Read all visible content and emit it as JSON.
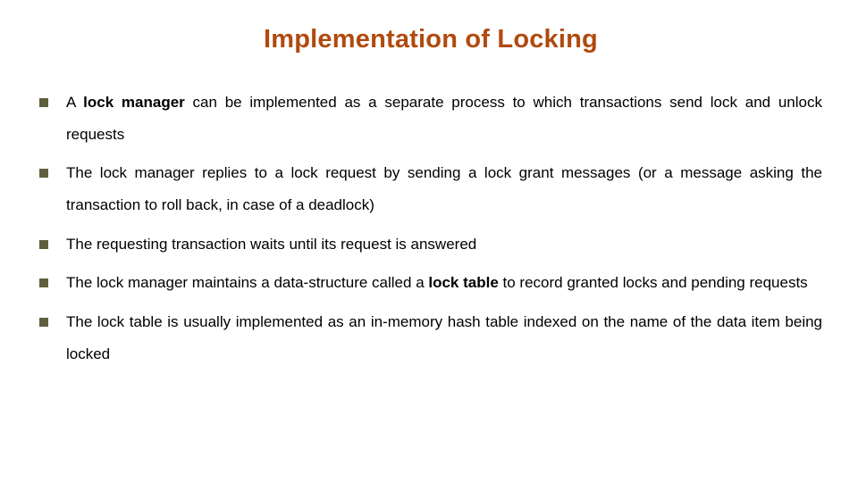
{
  "title": "Implementation of Locking",
  "bullets": [
    {
      "pre": "A ",
      "bold": "lock manager",
      "post": " can be implemented as a separate process to which transactions send lock and unlock requests"
    },
    {
      "pre": "The lock manager replies to a lock request by sending a lock grant messages (or a message asking the transaction to roll back, in case of  a deadlock)",
      "bold": "",
      "post": ""
    },
    {
      "pre": "The requesting transaction waits until its request is answered",
      "bold": "",
      "post": ""
    },
    {
      "pre": "The lock manager maintains a data-structure called a ",
      "bold": "lock table",
      "post": " to record granted locks and pending requests"
    },
    {
      "pre": "The lock table is usually implemented as an in-memory hash table indexed on the name of the data item being locked",
      "bold": "",
      "post": ""
    }
  ]
}
